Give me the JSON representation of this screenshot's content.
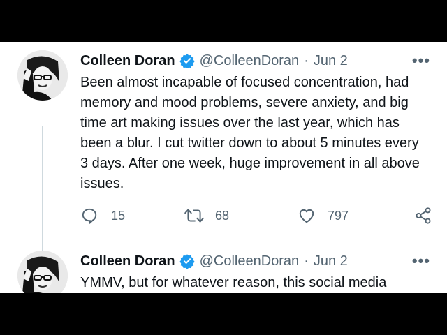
{
  "tweets": [
    {
      "author_name": "Colleen Doran",
      "handle": "@ColleenDoran",
      "separator": "·",
      "date": "Jun 2",
      "more_label": "•••",
      "text": "Been almost incapable of focused concentration, had memory and mood problems, severe anxiety, and big time art making issues over the last year, which has been a blur. I cut twitter down to about 5 minutes every 3 days. After one week, huge improvement in all above issues.",
      "replies": "15",
      "retweets": "68",
      "likes": "797"
    },
    {
      "author_name": "Colleen Doran",
      "handle": "@ColleenDoran",
      "separator": "·",
      "date": "Jun 2",
      "more_label": "•••",
      "text": "YMMV, but for whatever reason, this social media"
    }
  ],
  "colors": {
    "text": "#0f1419",
    "secondary": "#536471",
    "verified": "#1d9bf0",
    "thread_line": "#cfd9de"
  },
  "icons": [
    "reply-icon",
    "retweet-icon",
    "like-icon",
    "share-icon",
    "verified-badge-icon",
    "more-options-icon"
  ]
}
